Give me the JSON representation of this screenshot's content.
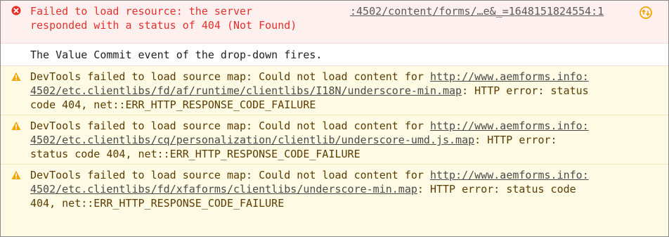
{
  "console": {
    "error": {
      "text_line1": "Failed to load resource: the server",
      "text_line2": "responded with a status of 404 (Not Found)",
      "source": ":4502/content/forms/…e&_=1648151824554:1",
      "icon": "error-circle-icon",
      "replay_icon": "network-request-icon"
    },
    "log": {
      "text": "The Value Commit event of the drop-down fires."
    },
    "warnings": [
      {
        "prefix": "DevTools failed to load source map: Could not load content for ",
        "link_part1": "http://www.aemforms.info:",
        "link_part2": "4502/etc.clientlibs/fd/af/runtime/clientlibs/I18N/underscore-min.map",
        "suffix_line2": ": HTTP error: status",
        "suffix_line3": "code 404, net::ERR_HTTP_RESPONSE_CODE_FAILURE"
      },
      {
        "prefix": "DevTools failed to load source map: Could not load content for ",
        "link_part1": "http://www.aemforms.info:",
        "link_part2": "4502/etc.clientlibs/cq/personalization/clientlib/underscore-umd.js.map",
        "suffix_line2": ": HTTP error:",
        "suffix_line3": "status code 404, net::ERR_HTTP_RESPONSE_CODE_FAILURE"
      },
      {
        "prefix": "DevTools failed to load source map: Could not load content for ",
        "link_part1": "http://www.aemforms.info:",
        "link_part2": "4502/etc.clientlibs/fd/xfaforms/clientlibs/underscore-min.map",
        "suffix_line2": ": HTTP error: status code",
        "suffix_line3": "404, net::ERR_HTTP_RESPONSE_CODE_FAILURE"
      }
    ]
  },
  "colors": {
    "error_text": "#e4322b",
    "error_bg": "#fff0f0",
    "warning_text": "#5c3c00",
    "warning_bg": "#fffbe5",
    "warning_icon": "#f2a600",
    "replay_icon": "#f2a600"
  }
}
